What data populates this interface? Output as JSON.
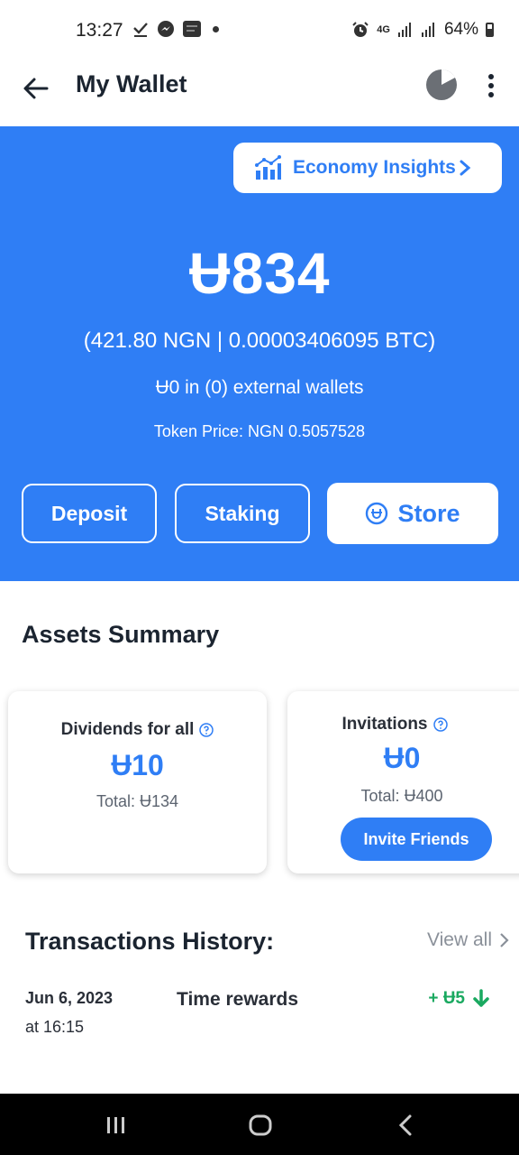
{
  "status_bar": {
    "time": "13:27",
    "network": "4G",
    "battery": "64%"
  },
  "app_bar": {
    "title": "My Wallet"
  },
  "hero": {
    "insights_label": "Economy Insights",
    "balance": "Ʉ834",
    "conversion": "(421.80 NGN | 0.00003406095 BTC)",
    "external_wallets": "Ʉ0 in (0) external wallets",
    "token_price": "Token Price: NGN 0.5057528",
    "deposit_label": "Deposit",
    "staking_label": "Staking",
    "store_label": "Store"
  },
  "assets": {
    "title": "Assets Summary",
    "dividends": {
      "label": "Dividends for all",
      "value": "Ʉ10",
      "total": "Total: Ʉ134"
    },
    "invitations": {
      "label": "Invitations",
      "value": "Ʉ0",
      "total": "Total: Ʉ400",
      "button_label": "Invite Friends"
    }
  },
  "transactions": {
    "title": "Transactions History:",
    "view_all_label": "View all",
    "items": [
      {
        "date": "Jun 6, 2023",
        "time": "at 16:15",
        "description": "Time rewards",
        "amount": "+ Ʉ5"
      }
    ]
  },
  "colors": {
    "primary": "#2f7ef5",
    "positive": "#1aa960",
    "text": "#1b2430"
  }
}
